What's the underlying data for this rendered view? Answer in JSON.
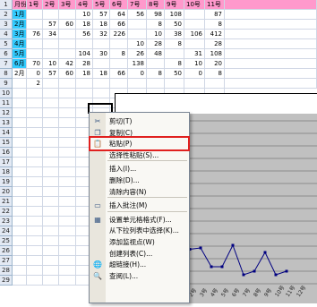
{
  "columns": [
    "月份",
    "1号",
    "2号",
    "3号",
    "4号",
    "5号",
    "6号",
    "7号",
    "8号",
    "9号",
    "10号",
    "11号"
  ],
  "rows": [
    {
      "n": "1",
      "cells": [
        "月份",
        "1号",
        "2号",
        "3号",
        "4号",
        "5号",
        "6号",
        "7号",
        "8号",
        "9号",
        "10号",
        "11号"
      ],
      "header": true
    },
    {
      "n": "2",
      "cells": [
        "1月",
        "",
        "",
        "",
        "10",
        "57",
        "64",
        "56",
        "98",
        "108",
        "",
        "87"
      ]
    },
    {
      "n": "3",
      "cells": [
        "2月",
        "",
        "57",
        "60",
        "18",
        "18",
        "66",
        "",
        "8",
        "50",
        "",
        "8"
      ]
    },
    {
      "n": "4",
      "cells": [
        "3月",
        "76",
        "34",
        "",
        "56",
        "32",
        "226",
        "",
        "10",
        "38",
        "106",
        "412"
      ]
    },
    {
      "n": "5",
      "cells": [
        "4月",
        "",
        "",
        "",
        "",
        "",
        "",
        "10",
        "28",
        "8",
        "",
        "28"
      ]
    },
    {
      "n": "6",
      "cells": [
        "5月",
        "",
        "",
        "",
        "104",
        "30",
        "8",
        "26",
        "48",
        "",
        "31",
        "108"
      ]
    },
    {
      "n": "7",
      "cells": [
        "6月",
        "70",
        "10",
        "42",
        "28",
        "",
        "",
        "138",
        "",
        "8",
        "10",
        "20"
      ]
    },
    {
      "n": "8",
      "cells": [
        "2月",
        "0",
        "57",
        "60",
        "18",
        "18",
        "66",
        "0",
        "8",
        "50",
        "0",
        "8"
      ],
      "plain": true
    },
    {
      "n": "9",
      "cells": [
        "",
        "2",
        "",
        "",
        "",
        "",
        "",
        "",
        "",
        "",
        "",
        ""
      ],
      "plain": true
    }
  ],
  "row_numbers": [
    "10",
    "11",
    "12",
    "13",
    "14",
    "15",
    "16",
    "17",
    "18",
    "19",
    "20",
    "21",
    "22",
    "23",
    "24",
    "25",
    "26",
    "27",
    "28",
    "29"
  ],
  "chart": {
    "xlabels": [
      "1号",
      "2号",
      "3号",
      "4号",
      "5号",
      "6号",
      "7号",
      "8号",
      "9号",
      "10号",
      "11号",
      "12号"
    ]
  },
  "menu": {
    "items": [
      {
        "label": "剪切(T)",
        "icon": "✂",
        "name": "cut"
      },
      {
        "label": "复制(C)",
        "icon": "❐",
        "name": "copy"
      },
      {
        "label": "粘贴(P)",
        "icon": "📋",
        "name": "paste",
        "highlight": true
      },
      {
        "label": "选择性粘贴(S)...",
        "icon": "",
        "name": "paste-special"
      },
      {
        "sep": true
      },
      {
        "label": "插入(I)...",
        "icon": "",
        "name": "insert"
      },
      {
        "label": "删除(D)...",
        "icon": "",
        "name": "delete"
      },
      {
        "label": "清除内容(N)",
        "icon": "",
        "name": "clear-contents"
      },
      {
        "sep": true
      },
      {
        "label": "插入批注(M)",
        "icon": "▭",
        "name": "insert-comment"
      },
      {
        "sep": true
      },
      {
        "label": "设置单元格格式(F)...",
        "icon": "▦",
        "name": "format-cells"
      },
      {
        "label": "从下拉列表中选择(K)...",
        "icon": "",
        "name": "pick-from-list"
      },
      {
        "label": "添加监视点(W)",
        "icon": "",
        "name": "add-watch"
      },
      {
        "label": "创建列表(C)...",
        "icon": "",
        "name": "create-list"
      },
      {
        "label": "超链接(H)...",
        "icon": "🌐",
        "name": "hyperlink"
      },
      {
        "label": "查阅(L)...",
        "icon": "🔍",
        "name": "lookup"
      }
    ]
  }
}
